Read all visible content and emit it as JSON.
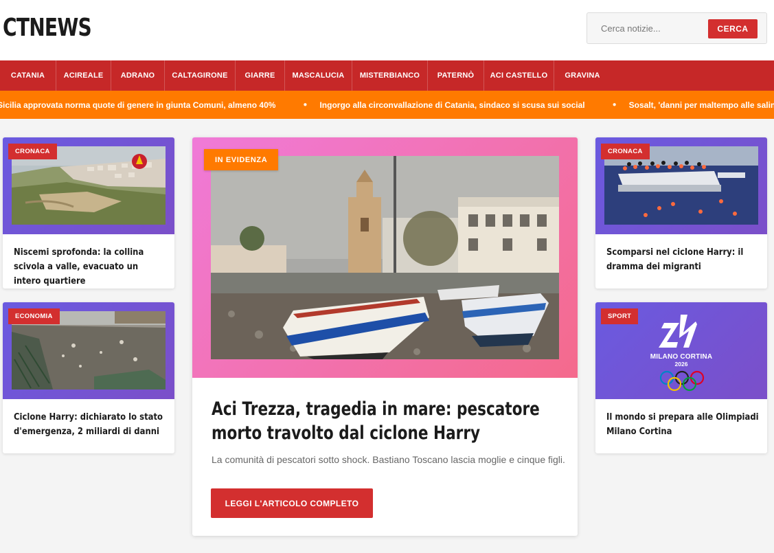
{
  "header": {
    "logo": "CTNEWS",
    "search_placeholder": "Cerca notizie...",
    "search_button": "CERCA"
  },
  "nav": {
    "items": [
      {
        "label": "CATANIA"
      },
      {
        "label": "ACIREALE"
      },
      {
        "label": "ADRANO"
      },
      {
        "label": "CALTAGIRONE"
      },
      {
        "label": "GIARRE"
      },
      {
        "label": "MASCALUCIA"
      },
      {
        "label": "MISTERBIANCO"
      },
      {
        "label": "PATERNÒ"
      },
      {
        "label": "ACI CASTELLO"
      },
      {
        "label": "GRAVINA"
      }
    ]
  },
  "ticker": {
    "items": [
      "Sicilia approvata norma quote di genere in giunta Comuni, almeno 40%",
      "Ingorgo alla circonvallazione di Catania, sindaco si scusa sui social",
      "Sosalt, 'danni per maltempo alle saline di Trapani"
    ]
  },
  "cards": {
    "left_top": {
      "badge": "CRONACA",
      "title": "Niscemi sprofonda: la collina scivola a valle, evacuato un intero quartiere"
    },
    "left_bottom": {
      "badge": "ECONOMIA",
      "title": "Ciclone Harry: dichiarato lo stato d'emergenza, 2 miliardi di danni"
    },
    "right_top": {
      "badge": "CRONACA",
      "title": "Scomparsi nel ciclone Harry: il dramma dei migranti"
    },
    "right_bottom": {
      "badge": "SPORT",
      "title": "Il mondo si prepara alle Olimpiadi Milano Cortina"
    }
  },
  "featured": {
    "badge": "IN EVIDENZA",
    "title": "Aci Trezza, tragedia in mare: pescatore morto travolto dal ciclone Harry",
    "subtitle": "La comunità di pescatori sotto shock. Bastiano Toscano lascia moglie e cinque figli.",
    "button": "LEGGI L'ARTICOLO COMPLETO"
  },
  "olympics_logo": {
    "line1": "MILANO CORTINA",
    "line2": "2026"
  },
  "colors": {
    "brand_red": "#c62828",
    "button_red": "#d32f2f",
    "ticker_orange": "#ff7a00",
    "card_gradient": "#6a5ae0",
    "featured_gradient": "#f07ad8"
  }
}
